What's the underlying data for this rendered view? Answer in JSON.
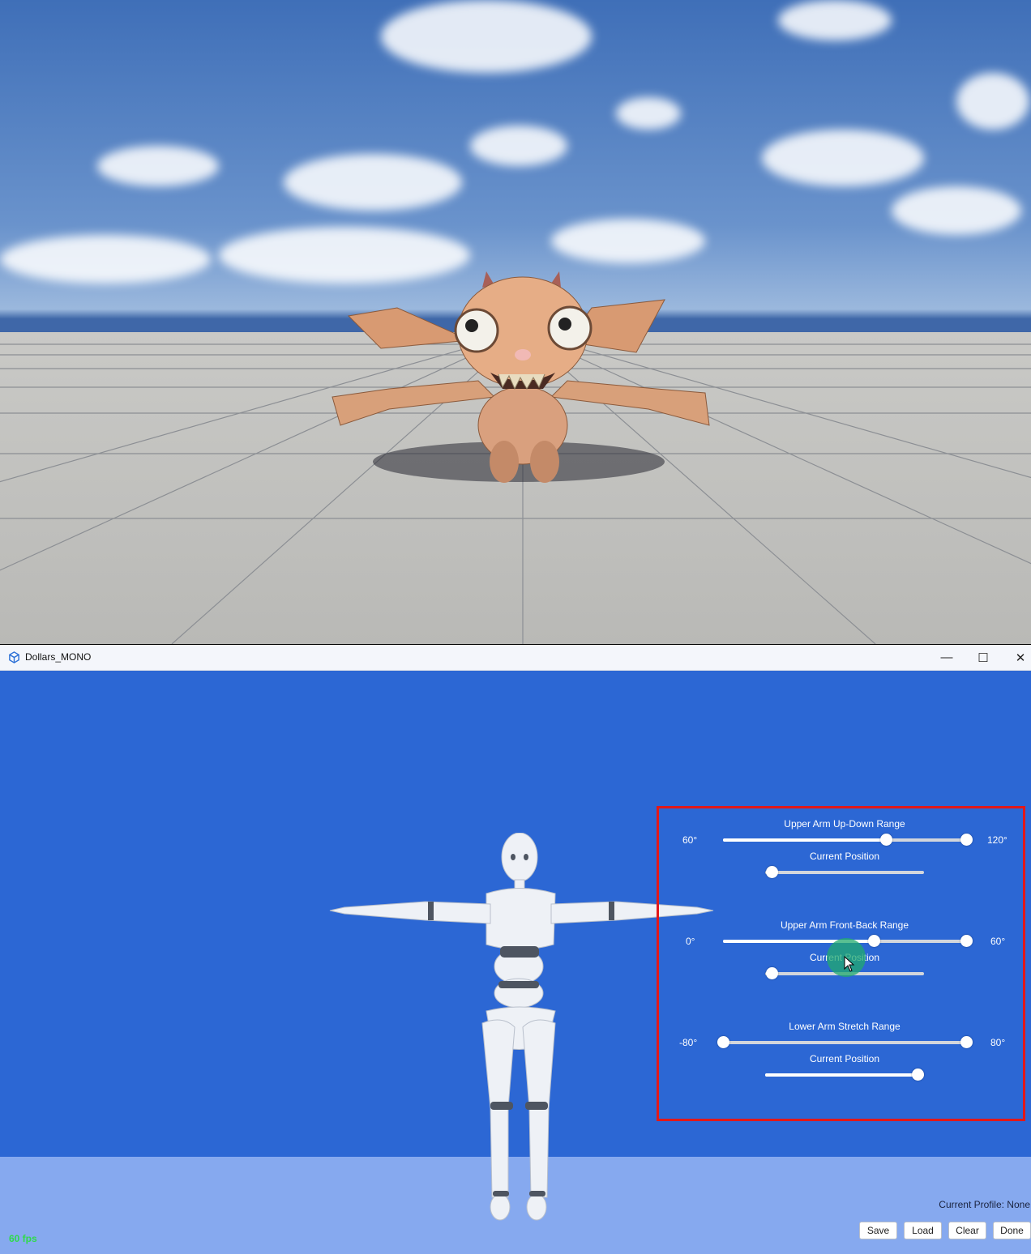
{
  "window": {
    "title": "Dollars_MONO",
    "minimize_glyph": "—",
    "maximize_glyph": "☐",
    "close_glyph": "✕"
  },
  "sliders": [
    {
      "title": "Upper Arm Up-Down Range",
      "min_label": "60°",
      "max_label": "120°",
      "range_low_fraction": 0.67,
      "range_high_fraction": 1.0,
      "current_label": "Current Position",
      "current_fraction": 0.0
    },
    {
      "title": "Upper Arm Front-Back Range",
      "min_label": "0°",
      "max_label": "60°",
      "range_low_fraction": 0.62,
      "range_high_fraction": 1.0,
      "current_label": "Current Position",
      "current_fraction": 0.0
    },
    {
      "title": "Lower Arm Stretch Range",
      "min_label": "-80°",
      "max_label": "80°",
      "range_low_fraction": 0.0,
      "range_high_fraction": 1.0,
      "current_label": "Current Position",
      "current_fraction": 1.0
    }
  ],
  "footer": {
    "profile": "Current Profile: None",
    "buttons": [
      "Save",
      "Load",
      "Clear",
      "Done"
    ],
    "fps": "60 fps"
  },
  "colors": {
    "app_background": "#2c67d4",
    "ground": "#86a9ef",
    "highlight_border": "#e31818",
    "fps_text": "#2fdb4a"
  },
  "icons": [
    "app-cube-icon",
    "minimize-icon",
    "maximize-icon",
    "close-icon",
    "mouse-cursor-icon"
  ]
}
